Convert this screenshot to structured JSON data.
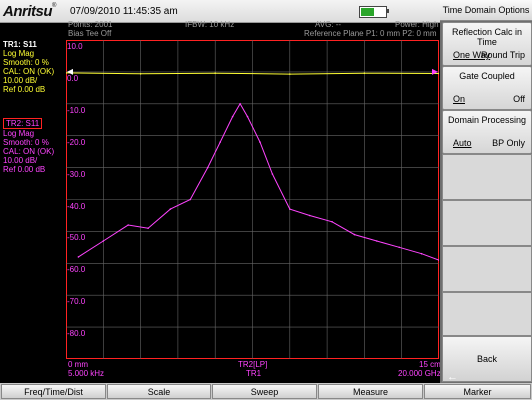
{
  "title_bar": {
    "logo": "Anritsu",
    "datetime": "07/09/2010 11:45:35 am",
    "battery_level": 0.6
  },
  "header": {
    "points": "Points: 2001",
    "bias_tee": "Bias Tee Off",
    "ifbw": "IFBW: 10 kHz",
    "avg": "AVG: --",
    "power": "Power: High",
    "ref_plane": "Reference Plane P1: 0 mm P2: 0 mm"
  },
  "trace1": {
    "name": "TR1: S11",
    "lines": [
      "Log Mag",
      "Smooth: 0 %",
      "CAL: ON (OK)",
      "10.00 dB/",
      "Ref 0.00 dB"
    ],
    "color": "#ffff33"
  },
  "trace2": {
    "name": "TR2: S11",
    "lines": [
      "Log Mag",
      "Smooth: 0 %",
      "CAL: ON (OK)",
      "10.00 dB/",
      "Ref 0.00 dB"
    ],
    "color": "#ff44ff"
  },
  "y_axis": [
    "10.0",
    "0.0",
    "-10.0",
    "-20.0",
    "-30.0",
    "-40.0",
    "-50.0",
    "-60.0",
    "-70.0",
    "-80.0"
  ],
  "footer": {
    "start_distance": "0 mm",
    "start_freq": "5.000 kHz",
    "center_label": "TR2[LP]",
    "center_sub": "TR1",
    "stop_distance": "15 cm",
    "stop_freq": "20.000 GHz"
  },
  "right_panel": {
    "title": "Time Domain Options",
    "reflection": {
      "label": "Reflection Calc in Time",
      "opt1": "One Way",
      "opt2": "Round Trip"
    },
    "gate": {
      "label": "Gate Coupled",
      "opt1": "On",
      "opt2": "Off"
    },
    "processing": {
      "label": "Domain Processing",
      "opt1": "Auto",
      "opt2": "BP Only"
    },
    "back": "Back"
  },
  "bottom_menu": [
    "Freq/Time/Dist",
    "Scale",
    "Sweep",
    "Measure",
    "Marker"
  ],
  "chart_data": {
    "type": "line",
    "xlabel": "",
    "ylabel": "",
    "xlim": [
      0,
      15
    ],
    "ylim": [
      -90,
      10
    ],
    "x_unit": "cm",
    "series": [
      {
        "name": "TR1",
        "color": "#ffff33",
        "x": [
          0,
          3,
          6,
          9,
          12,
          15
        ],
        "values": [
          -0.3,
          -0.6,
          -0.4,
          -0.7,
          -0.4,
          -0.5
        ]
      },
      {
        "name": "TR2",
        "color": "#ff44ff",
        "x": [
          0.5,
          1.5,
          2.5,
          3.3,
          4.2,
          5.0,
          5.7,
          6.2,
          6.7,
          7.0,
          7.3,
          7.8,
          8.3,
          9.0,
          9.8,
          10.7,
          11.6,
          12.5,
          13.4,
          14.3,
          15.0
        ],
        "values": [
          -58,
          -53,
          -48,
          -49,
          -43,
          -40,
          -30,
          -22,
          -14,
          -10,
          -14,
          -22,
          -32,
          -43,
          -45,
          -47,
          -51,
          -53,
          -55,
          -57,
          -59
        ]
      }
    ]
  }
}
